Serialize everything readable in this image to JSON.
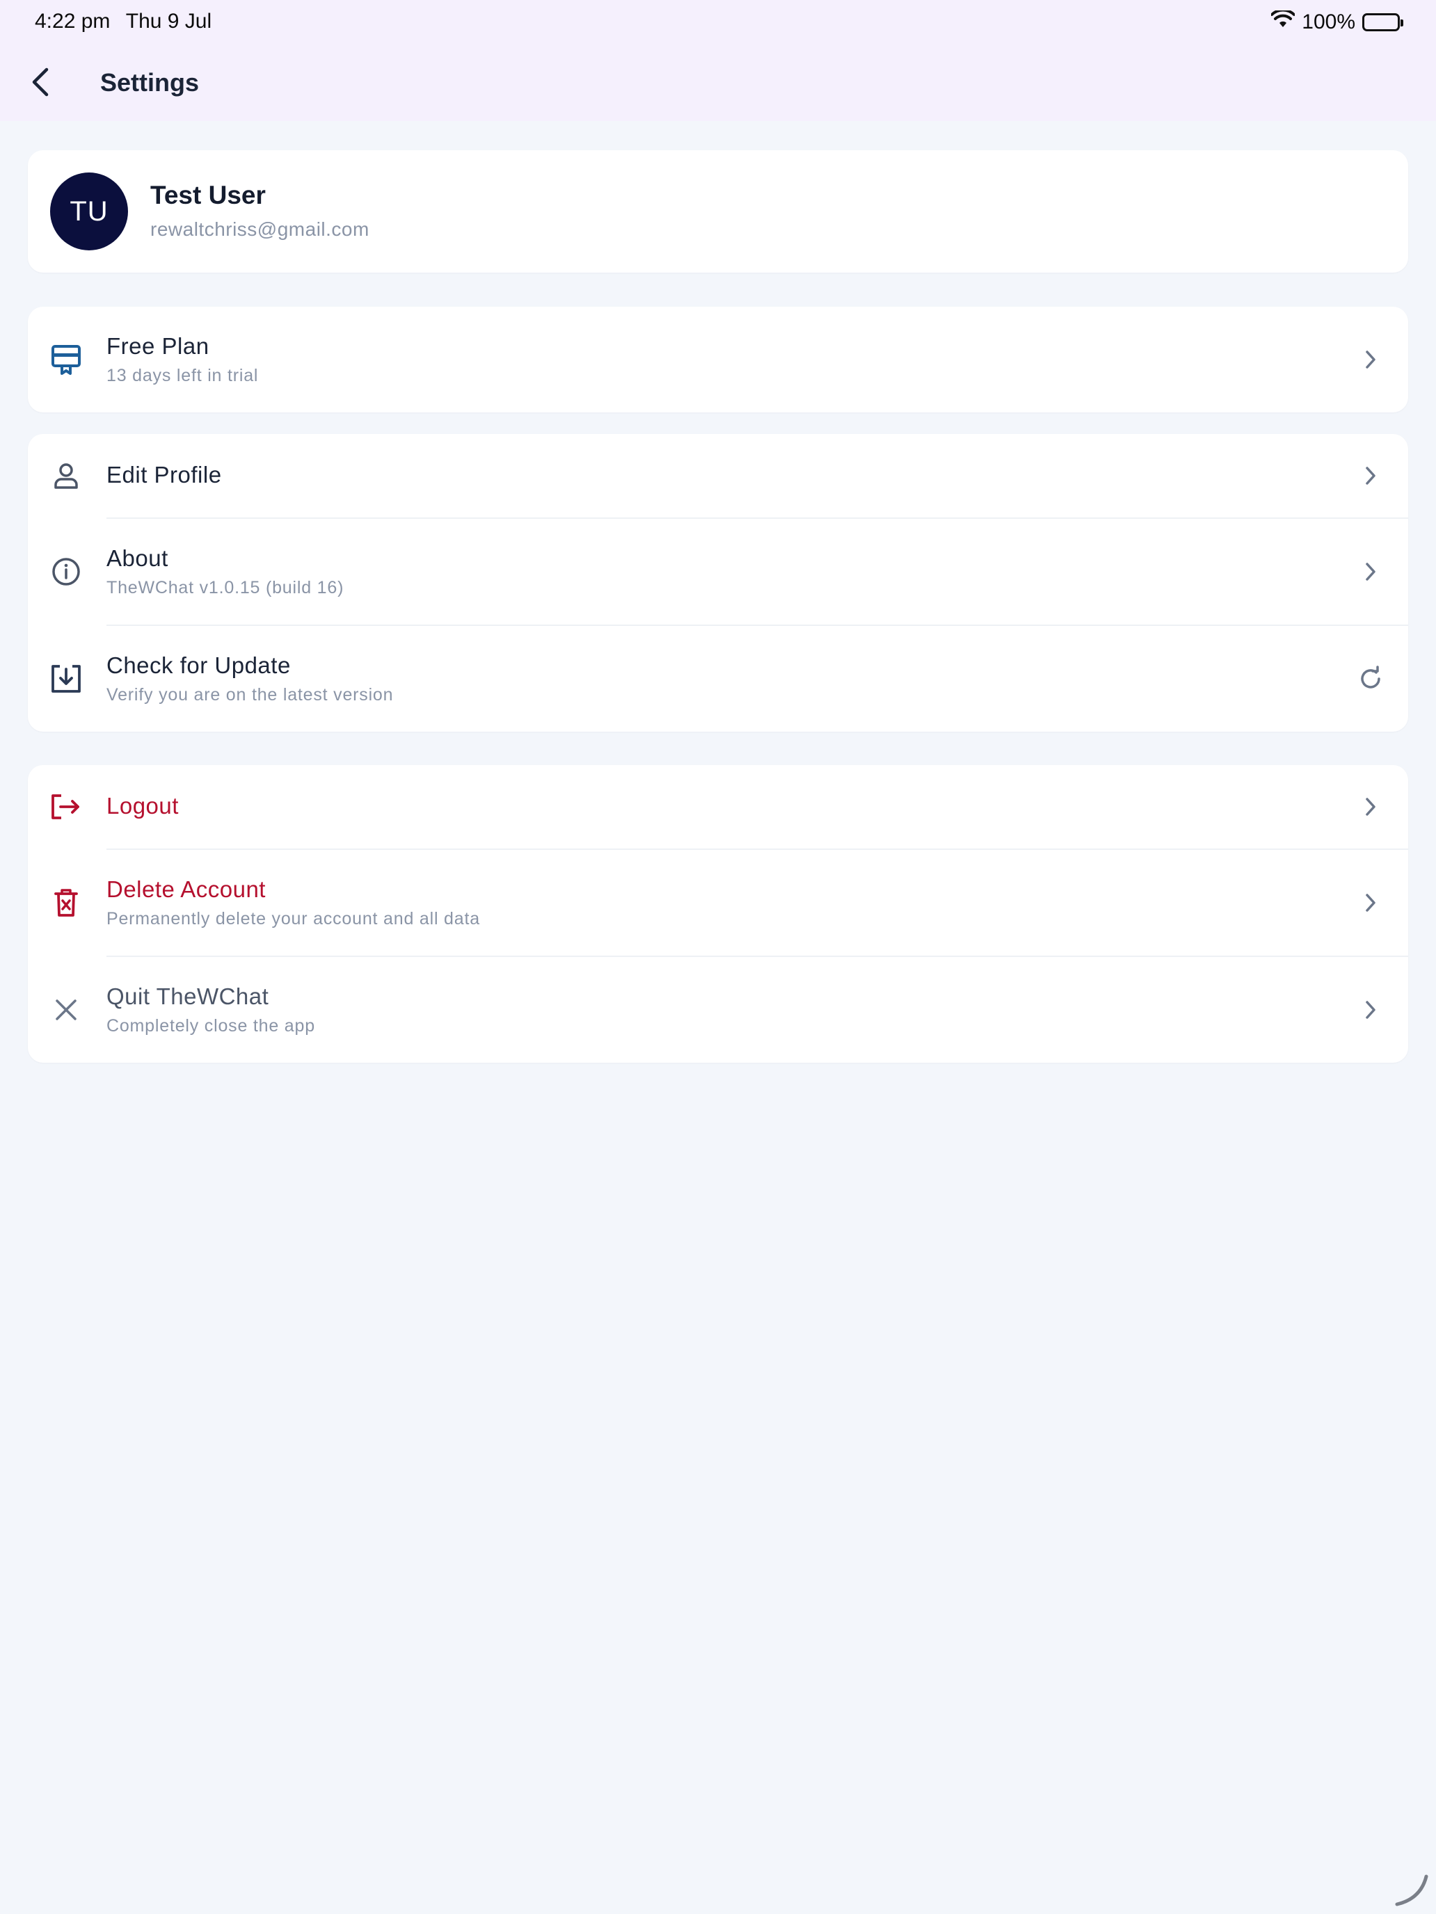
{
  "status_bar": {
    "time": "4:22 pm",
    "date": "Thu 9 Jul",
    "battery": "100%",
    "icons": [
      "wifi-icon",
      "battery-icon"
    ]
  },
  "header": {
    "title": "Settings",
    "back_icon": "chevron-left-icon"
  },
  "profile": {
    "initials": "TU",
    "name": "Test User",
    "email": "rewaltchriss@gmail.com"
  },
  "plan": {
    "title": "Free Plan",
    "subtitle": "13 days left in trial",
    "icon": "subscription-card-icon"
  },
  "settings_group": [
    {
      "title": "Edit Profile",
      "subtitle": "",
      "icon": "user-icon"
    },
    {
      "title": "About",
      "subtitle": "TheWChat v1.0.15 (build 16)",
      "icon": "info-icon"
    },
    {
      "title": "Check for Update",
      "subtitle": "Verify you are on the latest version",
      "icon": "download-icon"
    }
  ],
  "account_group": [
    {
      "title": "Logout",
      "subtitle": "",
      "icon": "logout-icon"
    },
    {
      "title": "Delete Account",
      "subtitle": "Permanently delete your account and all data",
      "icon": "trash-icon"
    },
    {
      "title": "Quit TheWChat",
      "subtitle": "Completely close the app",
      "icon": "close-icon"
    }
  ],
  "colors": {
    "header_bg": "#f5f0fd",
    "page_bg": "#f3f6fb",
    "avatar_bg": "#0b0f3d",
    "danger": "#b5102e",
    "plan_icon": "#1d5f9a"
  }
}
